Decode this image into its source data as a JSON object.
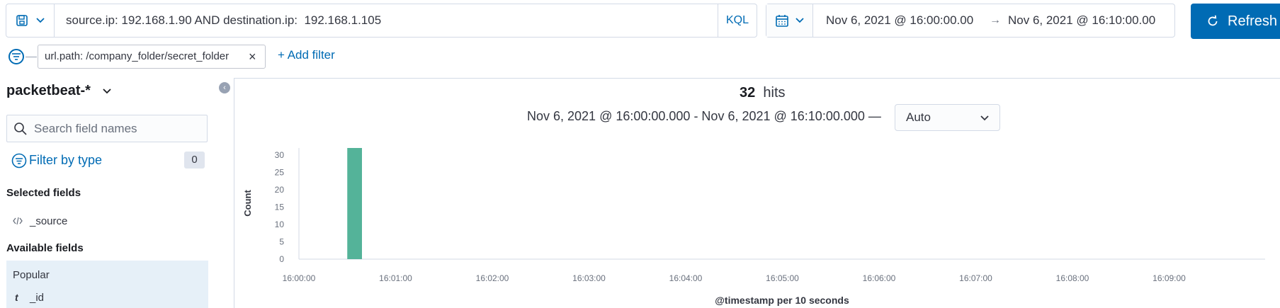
{
  "query": {
    "text": "source.ip: 192.168.1.90 AND destination.ip:  192.168.1.105",
    "language": "KQL"
  },
  "time": {
    "start": "Nov 6, 2021 @ 16:00:00.00",
    "arrow": "→",
    "end": "Nov 6, 2021 @ 16:10:00.00"
  },
  "refresh_label": "Refresh",
  "filters": {
    "pill": "url.path: /company_folder/secret_folder",
    "add_label": "+ Add filter"
  },
  "sidebar": {
    "index_pattern": "packetbeat-*",
    "search_placeholder": "Search field names",
    "filter_by_type": "Filter by type",
    "filter_count": "0",
    "selected_heading": "Selected fields",
    "selected_fields": [
      "_source"
    ],
    "available_heading": "Available fields",
    "popular_heading": "Popular",
    "popular_fields": [
      {
        "type": "t",
        "name": "_id"
      }
    ]
  },
  "results": {
    "hits_count": "32",
    "hits_label": "hits",
    "range_text": "Nov 6, 2021 @ 16:00:00.000 - Nov 6, 2021 @ 16:10:00.000 —",
    "interval": "Auto"
  },
  "colors": {
    "accent": "#006bb4",
    "bar": "#54b399"
  },
  "chart_data": {
    "type": "bar",
    "ylabel": "Count",
    "xlabel": "@timestamp per 10 seconds",
    "ylim": [
      0,
      32
    ],
    "yticks": [
      0,
      5,
      10,
      15,
      20,
      25,
      30
    ],
    "xticks": [
      "16:00:00",
      "16:01:00",
      "16:02:00",
      "16:03:00",
      "16:04:00",
      "16:05:00",
      "16:06:00",
      "16:07:00",
      "16:08:00",
      "16:09:00"
    ],
    "bars": [
      {
        "x": "16:00:30",
        "value": 32
      }
    ]
  }
}
